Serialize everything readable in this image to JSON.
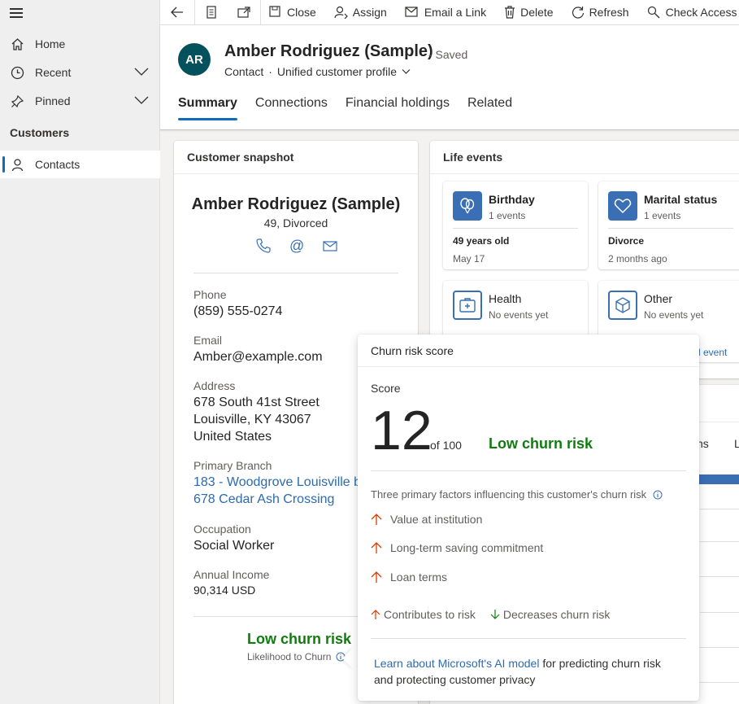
{
  "sidebar": {
    "items": [
      {
        "label": "Home"
      },
      {
        "label": "Recent"
      },
      {
        "label": "Pinned"
      }
    ],
    "section": "Customers",
    "contacts": "Contacts"
  },
  "commands": {
    "close": "Close",
    "assign": "Assign",
    "email_link": "Email a Link",
    "delete": "Delete",
    "refresh": "Refresh",
    "check_access": "Check Access"
  },
  "header": {
    "avatar": "AR",
    "title": "Amber Rodriguez (Sample)",
    "saved": "- Saved",
    "entity": "Contact",
    "dot": "·",
    "form": "Unified customer profile",
    "tabs": [
      "Summary",
      "Connections",
      "Financial holdings",
      "Related"
    ]
  },
  "snapshot": {
    "title": "Customer snapshot",
    "name": "Amber Rodriguez (Sample)",
    "sub": "49, Divorced",
    "phone_label": "Phone",
    "phone": "(859) 555-0274",
    "email_label": "Email",
    "email": "Amber@example.com",
    "address_label": "Address",
    "address1": "678 South 41st Street",
    "address2": "Louisville, KY 43067",
    "address3": "United States",
    "branch_label": "Primary Branch",
    "branch1": "183 - Woodgrove Louisville b",
    "branch2": "678 Cedar Ash Crossing",
    "occupation_label": "Occupation",
    "occupation": "Social Worker",
    "income_label": "Annual Income",
    "income": "90,314 USD",
    "churn": "Low churn risk",
    "churn_sub": "Likelihood to Churn"
  },
  "life_events": {
    "title": "Life events",
    "tiles": [
      {
        "title": "Birthday",
        "count": "1 events",
        "detail": "49 years old",
        "date": "May 17"
      },
      {
        "title": "Marital status",
        "count": "1 events",
        "detail": "Divorce",
        "date": "2 months ago"
      },
      {
        "title": "Health",
        "count": "No events yet"
      },
      {
        "title": "Other",
        "count": "No events yet"
      }
    ],
    "add_event_fragment": "l event"
  },
  "background": {
    "tab_fragment_1": "ns",
    "tab_fragment_2": "L"
  },
  "popup": {
    "title": "Churn risk score",
    "score_label": "Score",
    "score": "12",
    "of": "of 100",
    "risk": "Low churn risk",
    "factors_heading": "Three primary factors influencing this customer's churn risk",
    "factors": [
      "Value at institution",
      "Long-term saving commitment",
      "Loan terms"
    ],
    "legend_up": "Contributes to risk",
    "legend_down": "Decreases churn risk",
    "footer_link": "Learn about Microsoft's AI model",
    "footer_text": " for predicting churn risk and protecting customer privacy"
  },
  "colors": {
    "accent": "#0f6cbd",
    "risk_green": "#107c10",
    "arrow_up": "#d83b01",
    "arrow_down": "#107c10",
    "avatar_bg": "#04515e"
  }
}
